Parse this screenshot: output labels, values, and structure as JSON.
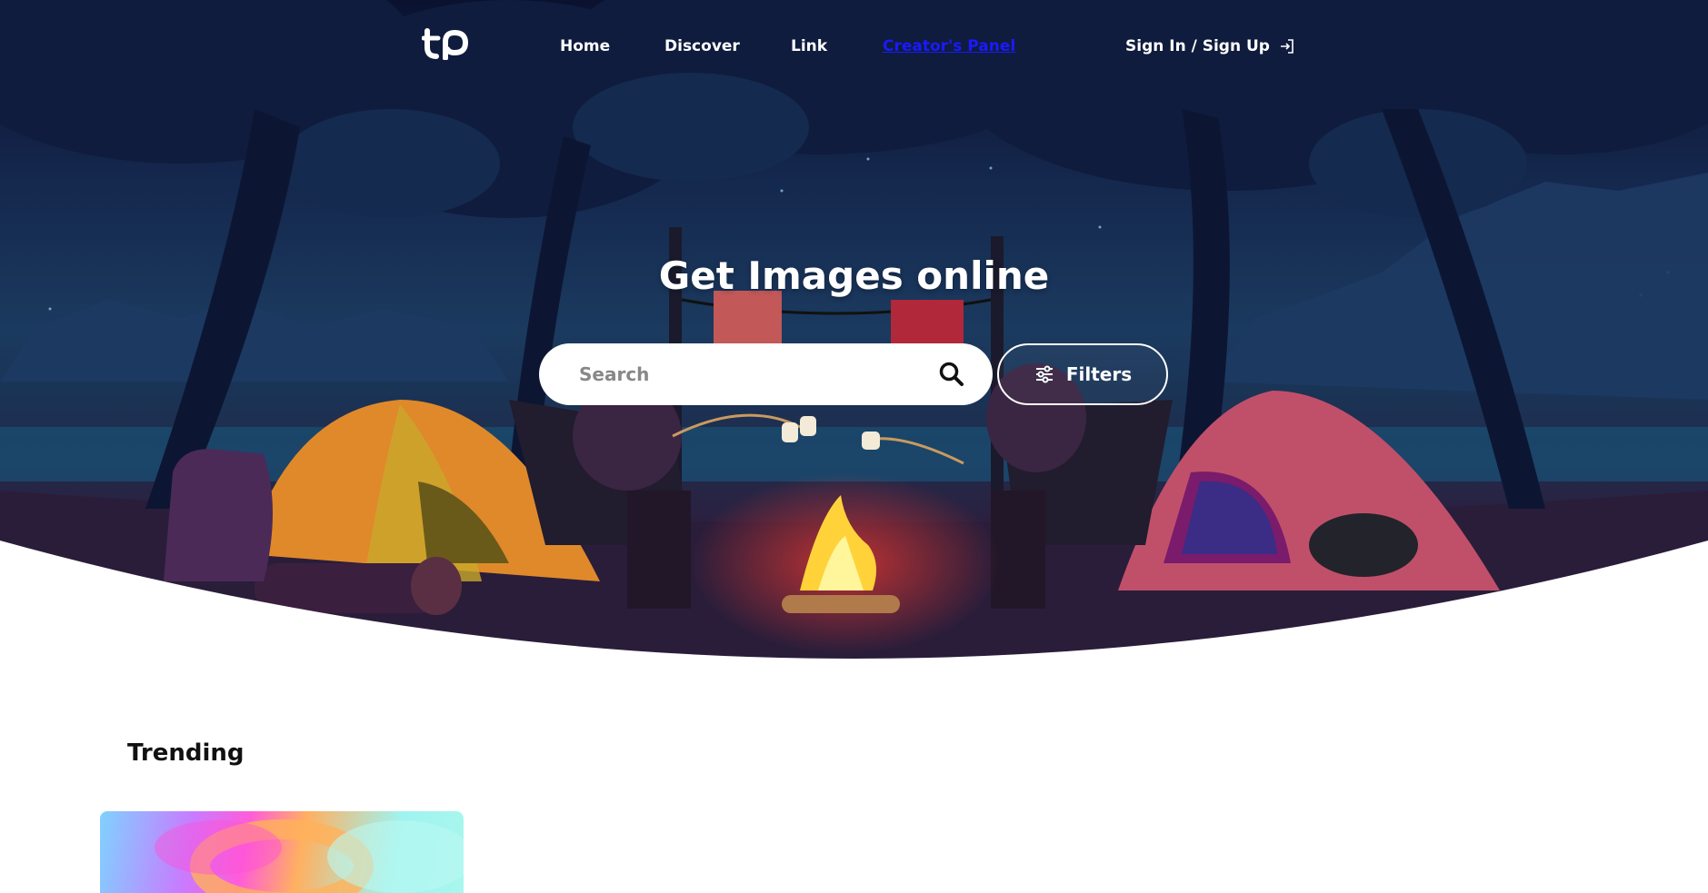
{
  "header": {
    "logo_text": "tp",
    "nav": [
      {
        "label": "Home",
        "active": false
      },
      {
        "label": "Discover",
        "active": false
      },
      {
        "label": "Link",
        "active": false
      },
      {
        "label": "Creator's Panel",
        "active": true
      }
    ],
    "signin_label": "Sign In / Sign Up"
  },
  "hero": {
    "title": "Get Images online",
    "search": {
      "placeholder": "Search",
      "value": ""
    },
    "filters_label": "Filters"
  },
  "trending": {
    "title": "Trending"
  },
  "icons": {
    "logo": "tp-logo",
    "signin": "sign-in-icon",
    "search": "search-icon",
    "filters": "sliders-icon"
  },
  "colors": {
    "active_link": "#1a1aff",
    "hero_dark": "#0a1230",
    "page_bg": "#ffffff"
  }
}
